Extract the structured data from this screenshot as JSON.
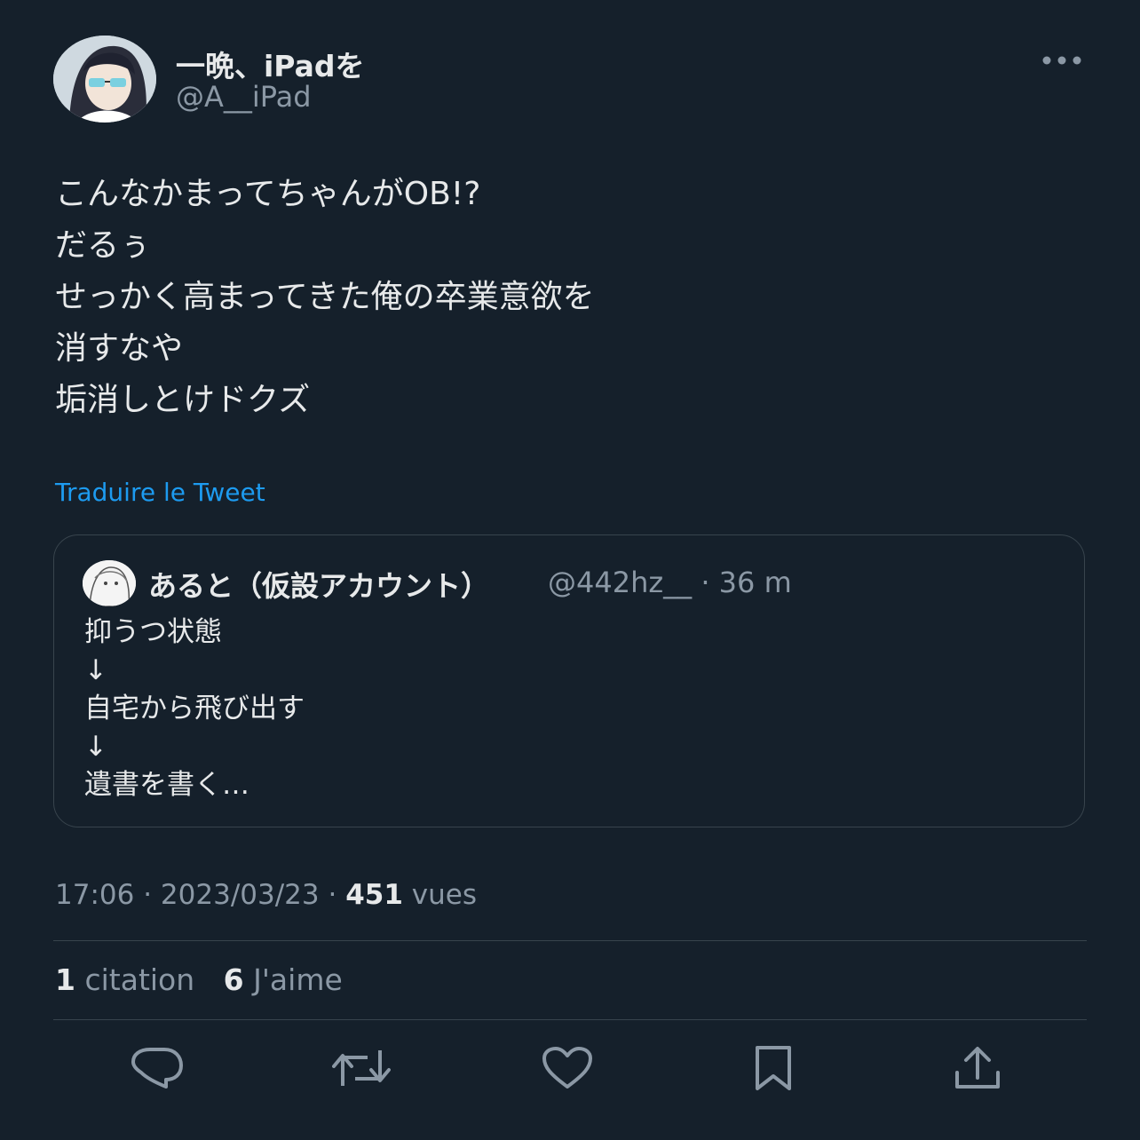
{
  "author": {
    "display_name": "一晩、iPadを",
    "handle": "@A__iPad"
  },
  "tweet": {
    "text": "こんなかまってちゃんがOB!?\nだるぅ\nせっかく高まってきた俺の卒業意欲を\n消すなや\n垢消しとけドクズ",
    "translate_label": "Traduire le Tweet"
  },
  "quote": {
    "display_name": "あると（仮設アカウント）",
    "handle": "@442hz__",
    "separator": "·",
    "time": "36 m",
    "text": "抑うつ状態\n↓\n自宅から飛び出す\n↓\n遺書を書く…"
  },
  "meta": {
    "time": "17:06",
    "date": "2023/03/23",
    "views_count": "451",
    "views_label": "vues",
    "sep": "·"
  },
  "stats": {
    "quotes_count": "1",
    "quotes_label": "citation",
    "likes_count": "6",
    "likes_label": "J'aime"
  },
  "icons": {
    "more": "more-icon",
    "reply": "reply-icon",
    "retweet": "retweet-icon",
    "like": "heart-icon",
    "bookmark": "bookmark-icon",
    "share": "share-icon"
  },
  "colors": {
    "background": "#15202b",
    "text": "#e7e9ea",
    "secondary": "#8b98a5",
    "accent": "#1d9bf0",
    "border": "#38444d"
  }
}
